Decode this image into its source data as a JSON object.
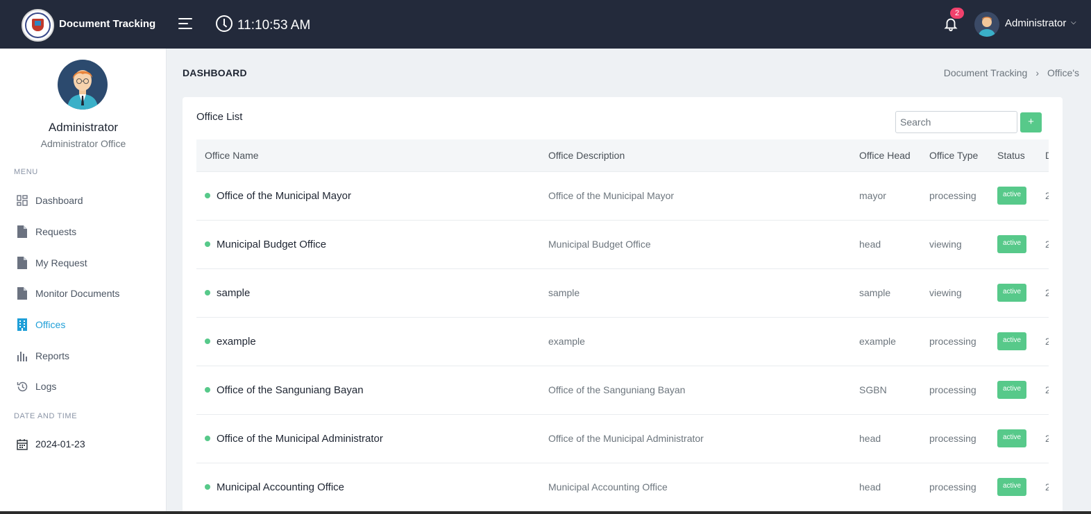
{
  "header": {
    "app_title": "Document Tracking",
    "time": "11:10:53 AM",
    "notification_count": "2",
    "user_name": "Administrator",
    "icons": [
      "menu-icon",
      "clock-icon",
      "bell-icon",
      "chevron-down-icon"
    ]
  },
  "sidebar": {
    "profile_name": "Administrator",
    "profile_role": "Administrator Office",
    "menu_label": "MENU",
    "items": [
      {
        "label": "Dashboard",
        "icon": "dashboard-icon"
      },
      {
        "label": "Requests",
        "icon": "file-icon"
      },
      {
        "label": "My Request",
        "icon": "file-icon"
      },
      {
        "label": "Monitor Documents",
        "icon": "file-icon"
      },
      {
        "label": "Offices",
        "icon": "building-icon",
        "active": true
      },
      {
        "label": "Reports",
        "icon": "bar-chart-icon"
      },
      {
        "label": "Logs",
        "icon": "history-icon"
      }
    ],
    "date_label": "DATE AND TIME",
    "date_value": "2024-01-23"
  },
  "page": {
    "title": "DASHBOARD",
    "breadcrumb": [
      "Document Tracking",
      "›",
      "Office's"
    ]
  },
  "card": {
    "title": "Office List",
    "search_placeholder": "Search",
    "add_label": "+",
    "columns": [
      "Office Name",
      "Office Description",
      "Office Head",
      "Office Type",
      "Status",
      "Date"
    ],
    "rows": [
      {
        "name": "Office of the Municipal Mayor",
        "description": "Office of the Municipal Mayor",
        "head": "mayor",
        "type": "processing",
        "status": "active",
        "date": "2"
      },
      {
        "name": "Municipal Budget Office",
        "description": "Municipal Budget Office",
        "head": "head",
        "type": "viewing",
        "status": "active",
        "date": "2"
      },
      {
        "name": "sample",
        "description": "sample",
        "head": "sample",
        "type": "viewing",
        "status": "active",
        "date": "2"
      },
      {
        "name": "example",
        "description": "example",
        "head": "example",
        "type": "processing",
        "status": "active",
        "date": "2"
      },
      {
        "name": "Office of the Sanguniang Bayan",
        "description": "Office of the Sanguniang Bayan",
        "head": "SGBN",
        "type": "processing",
        "status": "active",
        "date": "2"
      },
      {
        "name": "Office of the Municipal Administrator",
        "description": "Office of the Municipal Administrator",
        "head": "head",
        "type": "processing",
        "status": "active",
        "date": "2"
      },
      {
        "name": "Municipal Accounting Office",
        "description": "Municipal Accounting Office",
        "head": "head",
        "type": "processing",
        "status": "active",
        "date": "2"
      }
    ]
  },
  "colors": {
    "topbar": "#232a3b",
    "accent": "#1f9fd8",
    "success": "#57c98a",
    "badge": "#f1416c"
  }
}
